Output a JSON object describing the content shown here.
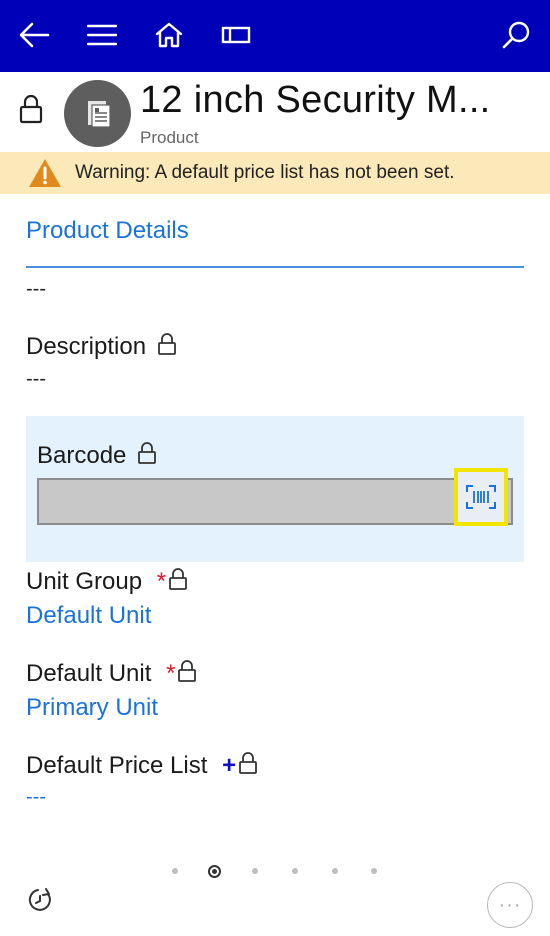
{
  "topbar": {
    "background": "#0000b8",
    "icons": [
      "back-arrow-icon",
      "menu-icon",
      "home-icon",
      "recent-icon",
      "search-icon"
    ]
  },
  "header": {
    "title": "12 inch Security M...",
    "subtitle": "Product",
    "lock_icon": "lock-icon",
    "avatar_icon": "product-document-icon"
  },
  "warning": {
    "text": "Warning: A default price list has not been set.",
    "icon": "warning-triangle-icon",
    "color": "#e08a1e"
  },
  "tab": {
    "label": "Product Details"
  },
  "fields": {
    "top_value": "---",
    "description": {
      "label": "Description",
      "value": "---"
    },
    "barcode": {
      "label": "Barcode",
      "value": ""
    },
    "unit_group": {
      "label": "Unit Group",
      "required": "*",
      "value": "Default Unit"
    },
    "default_unit": {
      "label": "Default Unit",
      "required": "*",
      "value": "Primary Unit"
    },
    "default_price_list": {
      "label": "Default Price List",
      "recommended": "+",
      "value": "---"
    }
  },
  "pager": {
    "count": 6,
    "active_index": 1
  },
  "footer": {
    "more_label": "···"
  },
  "colors": {
    "link": "#1a73d9",
    "required": "#e0142a",
    "highlight": "#f2e600"
  }
}
